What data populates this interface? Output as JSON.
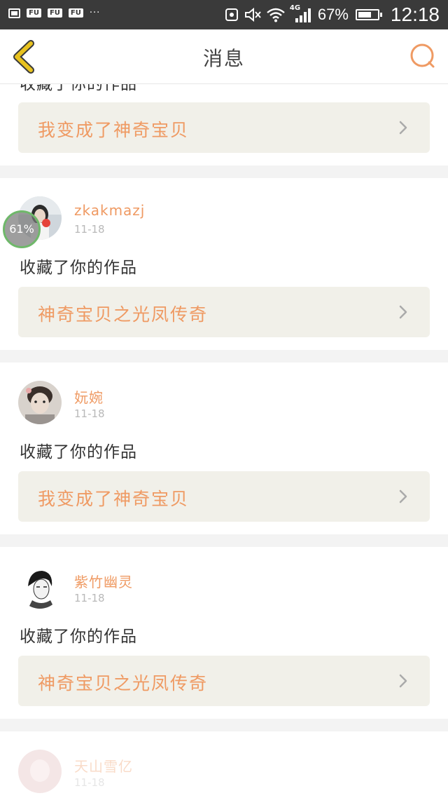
{
  "status_bar": {
    "tags": [
      "FU",
      "FU",
      "FU"
    ],
    "dots": "···",
    "network": "4G",
    "battery_percent": "67%",
    "time": "12:18"
  },
  "header": {
    "title": "消息"
  },
  "messages": [
    {
      "action": "收藏了你的作品",
      "work_title": "我变成了神奇宝贝"
    },
    {
      "username": "zkakmazj",
      "date": "11-18",
      "action": "收藏了你的作品",
      "work_title": "神奇宝贝之光凤传奇"
    },
    {
      "username": "妧婉",
      "date": "11-18",
      "action": "收藏了你的作品",
      "work_title": "我变成了神奇宝贝"
    },
    {
      "username": "紫竹幽灵",
      "date": "11-18",
      "action": "收藏了你的作品",
      "work_title": "神奇宝贝之光凤传奇"
    },
    {
      "username": "天山雪亿",
      "date": "11-18"
    }
  ],
  "progress_bubble": "61%",
  "colors": {
    "accent": "#ef9a63",
    "back_arrow": "#e8c21f",
    "status_bar": "#3a3a3a",
    "card_link_bg": "#f1f0e9"
  }
}
